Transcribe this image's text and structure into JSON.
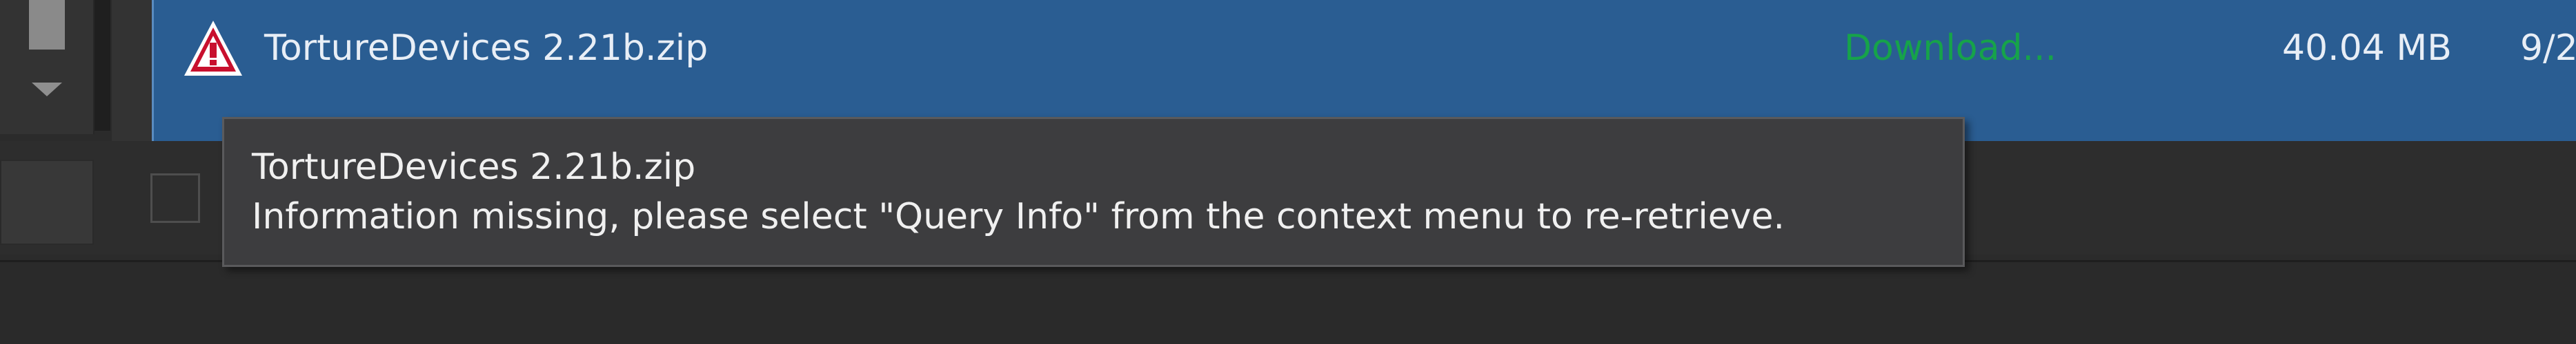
{
  "download_row": {
    "file_name": "TortureDevices 2.21b.zip",
    "status": "Download...",
    "size": "40.04 MB",
    "date_partial": "9/2",
    "status_icon": "warning-icon"
  },
  "tooltip": {
    "title": "TortureDevices 2.21b.zip",
    "message": "Information missing, please select \"Query Info\" from the context menu to re-retrieve."
  },
  "colors": {
    "row_selected": "#2a5d92",
    "status_text": "#16a34a",
    "warning_red": "#c8102e",
    "tooltip_bg": "#3d3d3f"
  }
}
